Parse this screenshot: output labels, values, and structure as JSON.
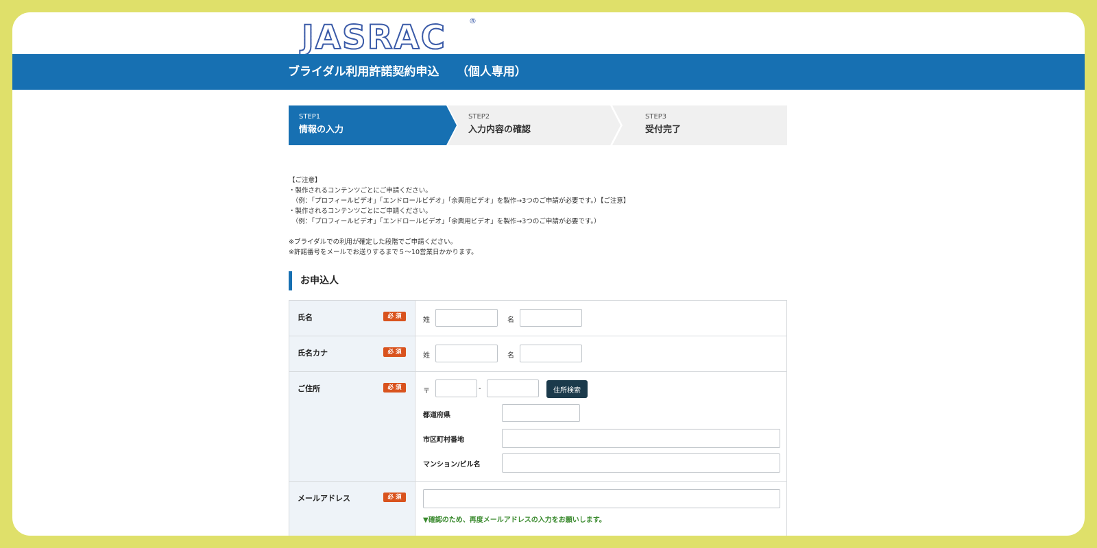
{
  "logo": {
    "text": "JASRAC",
    "registered": "®"
  },
  "banner": {
    "title": "ブライダル利用許諾契約申込　　（個人専用）"
  },
  "steps": [
    {
      "small": "STEP1",
      "label": "情報の入力",
      "state": "active"
    },
    {
      "small": "STEP2",
      "label": "入力内容の確認",
      "state": "idle"
    },
    {
      "small": "STEP3",
      "label": "受付完了",
      "state": "idle"
    }
  ],
  "notice": {
    "lines": [
      "【ご注意】",
      "・製作されるコンテンツごとにご申請ください。",
      "　（例：「プロフィールビデオ」「エンドロールビデオ」「余興用ビデオ」を製作→3つのご申請が必要です。）【ご注意】",
      "・製作されるコンテンツごとにご申請ください。",
      "　（例：「プロフィールビデオ」「エンドロールビデオ」「余興用ビデオ」を製作→3つのご申請が必要です。）",
      "",
      "※ブライダルでの利用が確定した段階でご申請ください。",
      "※許諾番号をメールでお送りするまで５〜10営業日かかります。"
    ]
  },
  "section": {
    "title": "お申込人"
  },
  "required_label": "必 須",
  "form": {
    "name": {
      "label": "氏名",
      "sei": "姓",
      "mei": "名",
      "sei_value": "",
      "mei_value": ""
    },
    "kana": {
      "label": "氏名カナ",
      "sei": "姓",
      "mei": "名",
      "sei_value": "",
      "mei_value": ""
    },
    "address": {
      "label": "ご住所",
      "postal_mark": "〒",
      "dash": "-",
      "search_button": "住所検索",
      "prefecture_label": "都道府県",
      "city_label": "市区町村番地",
      "building_label": "マンション/ビル名"
    },
    "email": {
      "label": "メールアドレス",
      "confirm_note": "▼確認のため、再度メールアドレスの入力をお願いします。"
    }
  },
  "colors": {
    "accent": "#1770b2",
    "required": "#d9531e",
    "button": "#1b3a4b",
    "note": "#3a8a2e"
  }
}
